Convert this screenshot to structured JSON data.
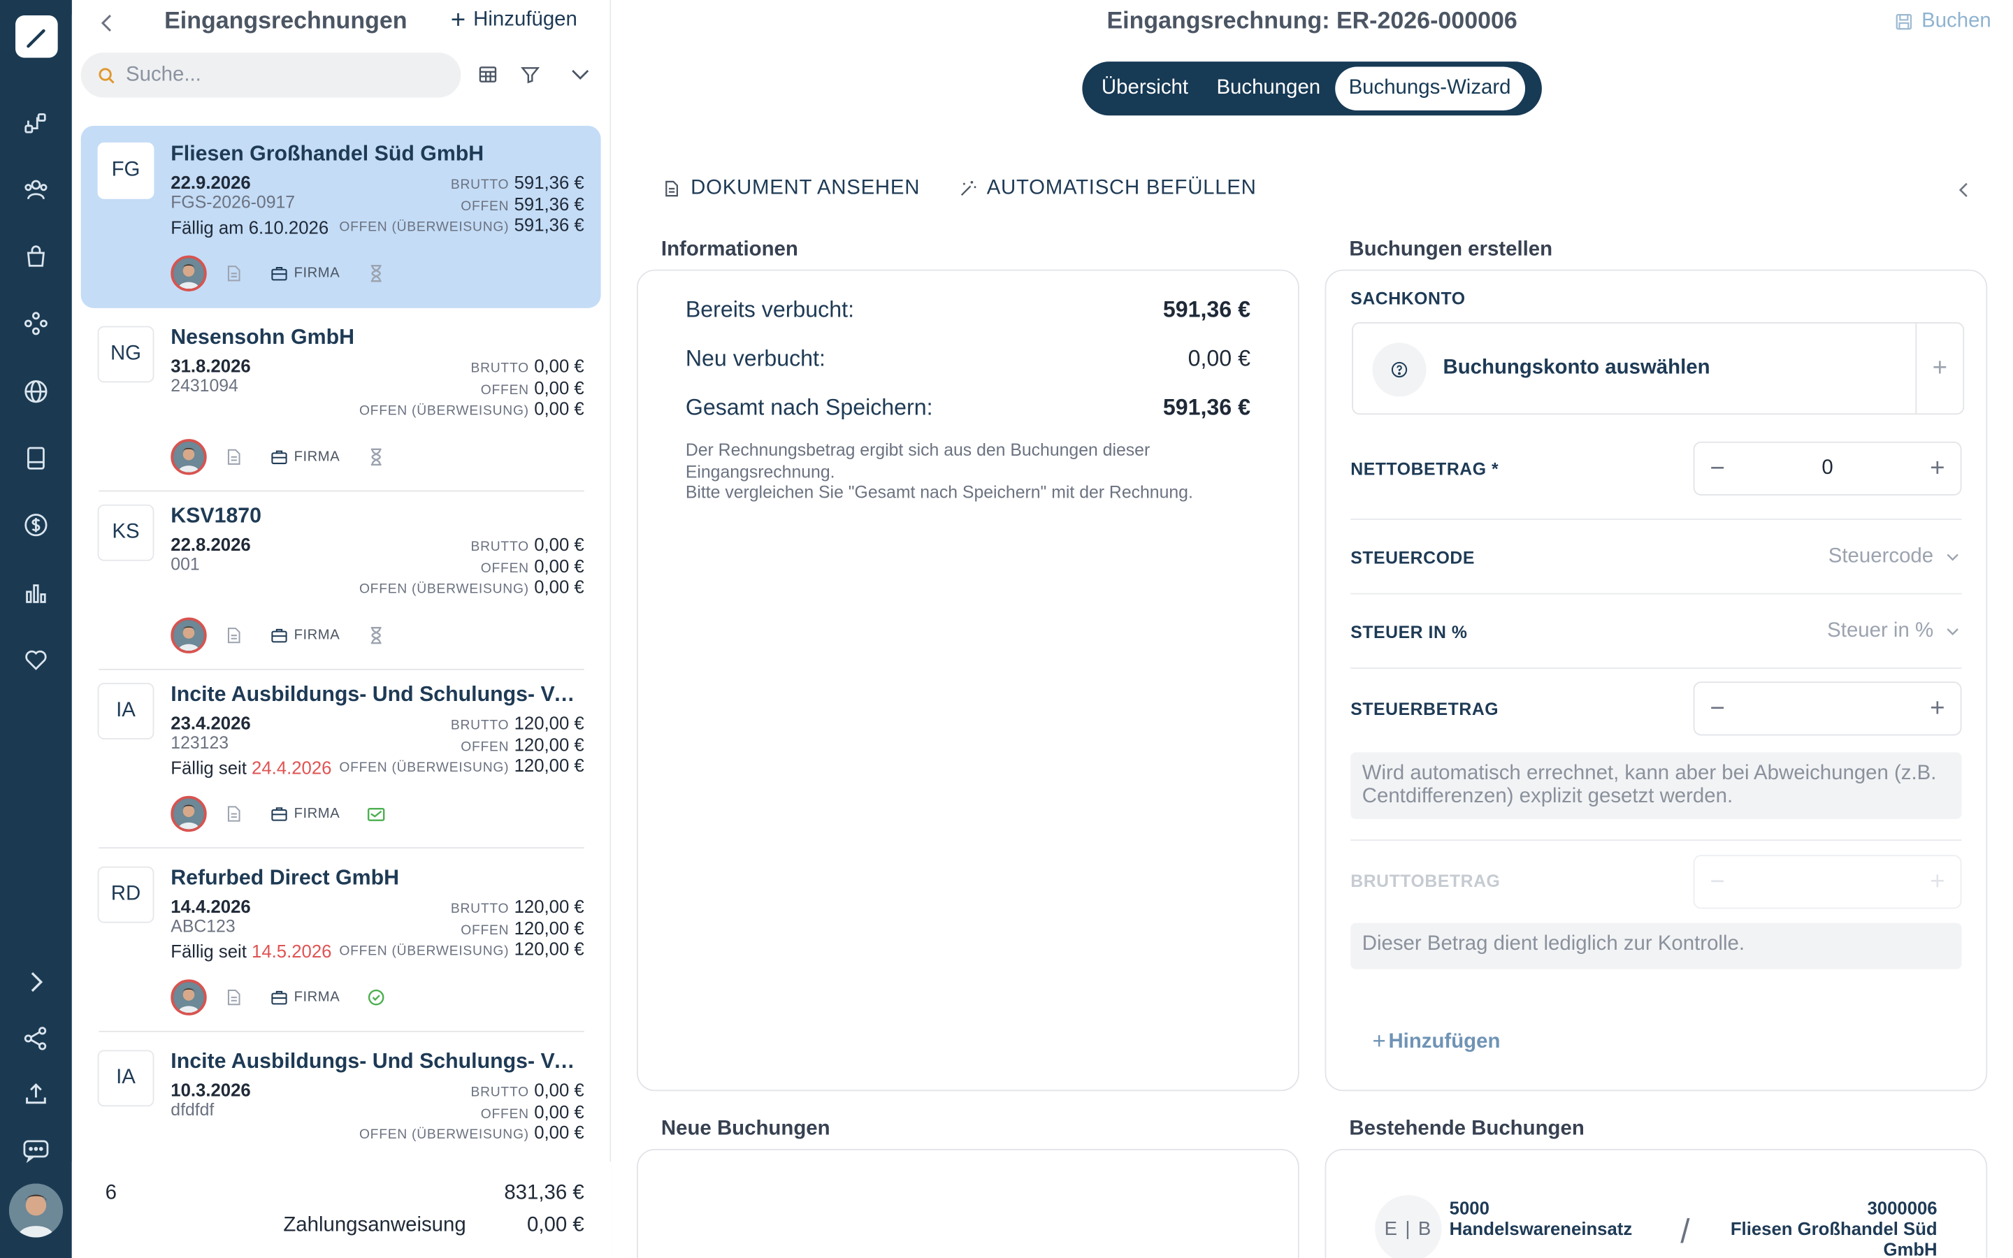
{
  "list": {
    "title": "Eingangsrechnungen",
    "add_label": "Hinzufügen",
    "search_placeholder": "Suche...",
    "invoices": [
      {
        "initials": "FG",
        "name": "Fliesen Großhandel Süd GmbH",
        "date": "22.9.2026",
        "ref": "FGS-2026-0917",
        "due_prefix": "Fällig am 6.10.2026",
        "due_date": "",
        "brutto_label": "BRUTTO",
        "brutto": "591,36 €",
        "offen_label": "OFFEN",
        "offen": "591,36 €",
        "ueb_label": "OFFEN (ÜBERWEISUNG)",
        "ueb": "591,36 €",
        "firm": "FIRMA",
        "status_icon": "hourglass-icon"
      },
      {
        "initials": "NG",
        "name": "Nesensohn GmbH",
        "date": "31.8.2026",
        "ref": "2431094",
        "due_prefix": "",
        "due_date": "",
        "brutto_label": "BRUTTO",
        "brutto": "0,00 €",
        "offen_label": "OFFEN",
        "offen": "0,00 €",
        "ueb_label": "OFFEN (ÜBERWEISUNG)",
        "ueb": "0,00 €",
        "firm": "FIRMA",
        "status_icon": "hourglass-icon"
      },
      {
        "initials": "KS",
        "name": "KSV1870",
        "date": "22.8.2026",
        "ref": "001",
        "due_prefix": "",
        "due_date": "",
        "brutto_label": "BRUTTO",
        "brutto": "0,00 €",
        "offen_label": "OFFEN",
        "offen": "0,00 €",
        "ueb_label": "OFFEN (ÜBERWEISUNG)",
        "ueb": "0,00 €",
        "firm": "FIRMA",
        "status_icon": "hourglass-icon"
      },
      {
        "initials": "IA",
        "name": "Incite Ausbildungs- Und Schulungs- Ver...",
        "date": "23.4.2026",
        "ref": "123123",
        "due_prefix": "Fällig seit ",
        "due_date": "24.4.2026",
        "brutto_label": "BRUTTO",
        "brutto": "120,00 €",
        "offen_label": "OFFEN",
        "offen": "120,00 €",
        "ueb_label": "OFFEN (ÜBERWEISUNG)",
        "ueb": "120,00 €",
        "firm": "FIRMA",
        "status_icon": "bank-transfer-icon"
      },
      {
        "initials": "RD",
        "name": "Refurbed Direct GmbH",
        "date": "14.4.2026",
        "ref": "ABC123",
        "due_prefix": "Fällig seit ",
        "due_date": "14.5.2026",
        "brutto_label": "BRUTTO",
        "brutto": "120,00 €",
        "offen_label": "OFFEN",
        "offen": "120,00 €",
        "ueb_label": "OFFEN (ÜBERWEISUNG)",
        "ueb": "120,00 €",
        "firm": "FIRMA",
        "status_icon": "check-circle-icon"
      },
      {
        "initials": "IA",
        "name": "Incite Ausbildungs- Und Schulungs- Ver...",
        "date": "10.3.2026",
        "ref": "dfdfdf",
        "due_prefix": "",
        "due_date": "",
        "brutto_label": "BRUTTO",
        "brutto": "0,00 €",
        "offen_label": "OFFEN",
        "offen": "0,00 €",
        "ueb_label": "OFFEN (ÜBERWEISUNG)",
        "ueb": "0,00 €",
        "firm": "FIRMA",
        "status_icon": "hourglass-icon"
      }
    ],
    "footer": {
      "count": "6",
      "sum": "831,36 €",
      "zahlung_label": "Zahlungsanweisung",
      "zahlung_value": "0,00 €"
    }
  },
  "header": {
    "title": "Eingangsrechnung: ER-2026-000006",
    "book_label": "Buchen",
    "tabs": [
      "Übersicht",
      "Buchungen",
      "Buchungs-Wizard"
    ],
    "active_tab": "Buchungs-Wizard"
  },
  "actions": {
    "view_doc": "DOKUMENT ANSEHEN",
    "autofill": "AUTOMATISCH BEFÜLLEN"
  },
  "info": {
    "section_label": "Informationen",
    "rows": [
      {
        "label": "Bereits verbucht:",
        "value": "591,36 €"
      },
      {
        "label": "Neu verbucht:",
        "value": "0,00 €"
      },
      {
        "label": "Gesamt nach Speichern:",
        "value": "591,36 €"
      }
    ],
    "note_line1": "Der Rechnungsbetrag ergibt sich aus den Buchungen dieser Eingangsrechnung.",
    "note_line2": "Bitte vergleichen Sie \"Gesamt nach Speichern\" mit der Rechnung."
  },
  "booking_form": {
    "section_label": "Buchungen erstellen",
    "sachkonto_label": "SACHKONTO",
    "account_placeholder": "Buchungskonto auswählen",
    "netto_label": "NETTOBETRAG *",
    "netto_value": "0",
    "steuercode_label": "STEUERCODE",
    "steuercode_placeholder": "Steuercode",
    "steuer_pct_label": "STEUER IN %",
    "steuer_pct_placeholder": "Steuer in %",
    "steuerbetrag_label": "STEUERBETRAG",
    "steuerbetrag_hint": "Wird automatisch errechnet, kann aber bei Abweichungen (z.B. Centdifferenzen) explizit gesetzt werden.",
    "brutto_label": "BRUTTOBETRAG",
    "brutto_hint": "Dieser Betrag dient lediglich zur Kontrolle.",
    "add_label": "Hinzufügen"
  },
  "new_bookings": {
    "section_label": "Neue Buchungen"
  },
  "existing_bookings": {
    "section_label": "Bestehende Buchungen",
    "badge": "E | B",
    "debit_number": "5000",
    "debit_name": "Handelswareneinsatz",
    "credit_number": "3000006",
    "credit_name": "Fliesen Großhandel Süd GmbH"
  },
  "colors": {
    "rail": "#1b3a52",
    "accent": "#1e3a55",
    "selected_card": "#c4dcf6",
    "overdue": "#e05353"
  }
}
